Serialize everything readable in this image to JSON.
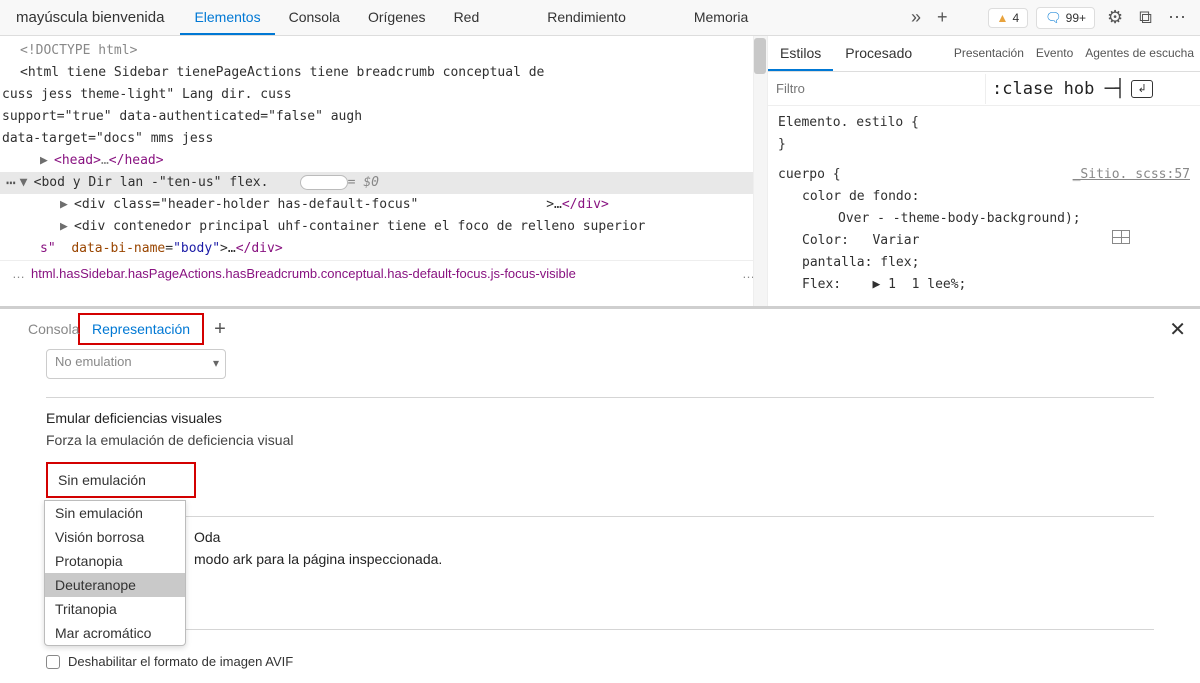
{
  "toolbar": {
    "title": "mayúscula bienvenida",
    "tabs": [
      "Elementos",
      "Consola",
      "Orígenes",
      "Red",
      "Rendimiento",
      "Memoria"
    ],
    "active_tab": 0,
    "more_tabs_glyph": "»",
    "add_tab_glyph": "+",
    "warn_count": "4",
    "info_count": "99+",
    "gear_glyph": "⚙",
    "devices_glyph": "⧉",
    "kebab_glyph": "⋯"
  },
  "dom": {
    "doctype": "<!DOCTYPE html>",
    "html_line1": "<html tiene Sidebar tienePageActions tiene breadcrumb conceptual de",
    "html_line2": "cuss jess theme-light\" Lang dir. cuss",
    "html_line3": "support=\"true\" data-authenticated=\"false\" augh",
    "html_line4": "data-target=\"docs\" mms jess",
    "head_open": "<head>",
    "head_ellipsis": "…",
    "head_close": "</head>",
    "body_open": "<bod y",
    "body_attrs": "  Dir lan -\"ten-us\" flex.",
    "body_eq": "== $0",
    "div1_open": "<div class=\"header-holder has-default-focus\"",
    "div1_mid": ">…",
    "div1_close": "</div>",
    "div2_text": "<div contenedor principal uhf-container tiene el foco de relleno superior",
    "line_s": "s\"",
    "attr_name": "data-bi-name",
    "attr_eq": "=",
    "attr_val": "\"body\"",
    "close_gt": ">…",
    "close_div": "</div>",
    "breadcrumb_left": "…",
    "breadcrumb": "html.hasSidebar.hasPageActions.hasBreadcrumb.conceptual.has-default-focus.js-focus-visible",
    "breadcrumb_right": "…"
  },
  "styles_panel": {
    "tabs": [
      "Estilos",
      "Procesado"
    ],
    "tabs_right": [
      "Presentación",
      "Evento",
      "Agentes de escucha"
    ],
    "filter_placeholder": "Filtro",
    "cls_label": ":clase hob ─┤",
    "toggle_back_glyph": "↲",
    "block0_sel": "Elemento. estilo {",
    "block0_close": "}",
    "block1_sel": "cuerpo {",
    "block1_src": "_Sitio. scss:57",
    "prop1_name": "color de fondo:",
    "prop1_val": "Over - -theme-body-background);",
    "prop2_name": "Color:",
    "prop2_val": "Variar",
    "prop3_name": "pantalla:",
    "prop3_val": "flex;",
    "prop4_name": "Flex:",
    "prop4_play": "▶",
    "prop4_num": "1",
    "prop4_val": "1 lee%;"
  },
  "drawer": {
    "tab_console": "Consola",
    "tab_rendering": "Representación",
    "plus_glyph": "+",
    "close_glyph": "✕",
    "emu_select_value": "No emulation",
    "section1_title": "Emular deficiencias visuales",
    "section1_desc": "Forza la emulación de deficiencia visual",
    "red_select_value": "Sin emulación",
    "dropdown_options": [
      "Sin emulación",
      "Visión borrosa",
      "Protanopia",
      "Deuteranope",
      "Tritanopia",
      "Mar acromático"
    ],
    "dropdown_highlight_index": 3,
    "inline_after_top": "Oda",
    "inline_after_bottom": "modo ark para la página inspeccionada.",
    "avif_label": "Deshabilitar el formato de imagen AVIF"
  }
}
